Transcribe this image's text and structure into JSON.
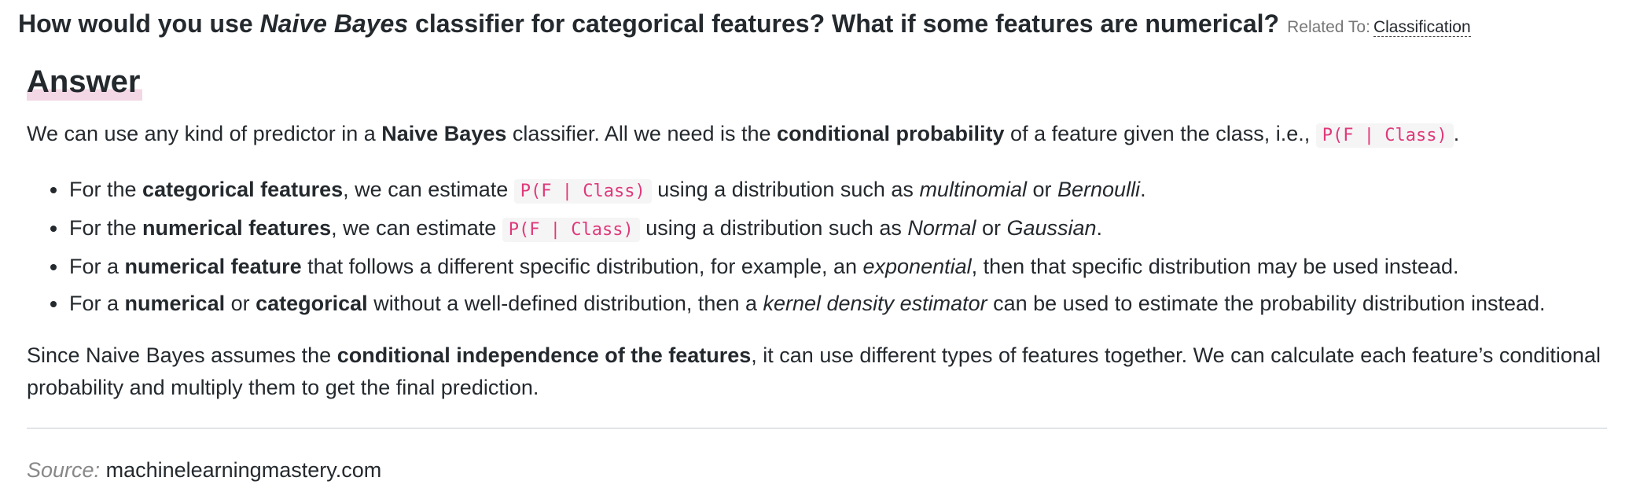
{
  "question": {
    "prefix": "How would you use ",
    "emphasis": "Naive Bayes",
    "suffix": " classifier for categorical features? What if some features are numerical?",
    "related_label": "Related To:",
    "related_link": "Classification"
  },
  "answer_heading": "Answer",
  "intro": {
    "t1": "We can use any kind of predictor in a ",
    "b1": "Naive Bayes",
    "t2": " classifier. All we need is the ",
    "b2": "conditional probability",
    "t3": " of a feature given the class, i.e., ",
    "code": "P(F | Class)",
    "t4": "."
  },
  "bullets": [
    {
      "t1": "For the ",
      "b1": "categorical features",
      "t2": ", we can estimate ",
      "code": "P(F | Class)",
      "t3": " using a distribution such as ",
      "i1": "multinomial",
      "t4": " or ",
      "i2": "Bernoulli",
      "t5": "."
    },
    {
      "t1": "For the ",
      "b1": "numerical features",
      "t2": ", we can estimate ",
      "code": "P(F | Class)",
      "t3": " using a distribution such as ",
      "i1": "Normal",
      "t4": " or ",
      "i2": "Gaussian",
      "t5": "."
    },
    {
      "t1": "For a ",
      "b1": "numerical feature",
      "t2": " that follows a different specific distribution, for example, an ",
      "i1": "exponential",
      "t3": ", then that specific distribution may be used instead."
    },
    {
      "t1": "For a ",
      "b1": "numerical",
      "t2": " or ",
      "b2": "categorical",
      "t3": " without a well-defined distribution, then a ",
      "i1": "kernel density estimator",
      "t4": " can be used to estimate the probability distribution instead."
    }
  ],
  "closing": {
    "t1": "Since Naive Bayes assumes the ",
    "b1": "conditional independence of the features",
    "t2": ", it can use different types of features together. We can calculate each feature’s conditional probability and multiply them to get the final prediction."
  },
  "source": {
    "label": "Source:",
    "link": "machinelearningmastery.com"
  },
  "colors": {
    "text": "#24292e",
    "code_text": "#e0387a",
    "code_bg": "#f5f5f5",
    "heading_highlight": "#f3d7e4",
    "muted": "#777777",
    "divider": "#e1e4e8"
  }
}
